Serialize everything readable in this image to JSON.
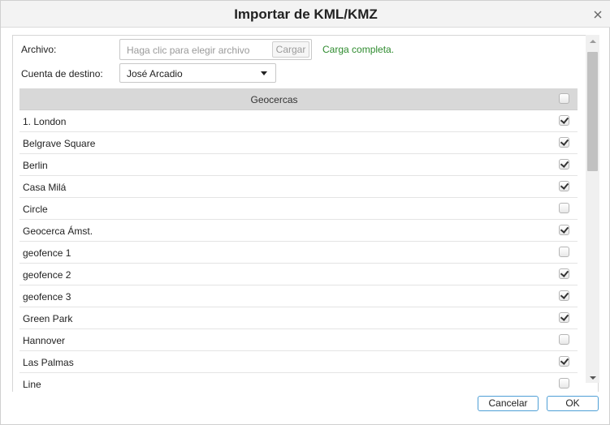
{
  "dialog": {
    "title": "Importar de KML/KMZ",
    "close_icon": "close-icon"
  },
  "form": {
    "file_label": "Archivo:",
    "file_placeholder": "Haga clic para elegir archivo",
    "upload_label": "Cargar",
    "status": "Carga completa.",
    "status_color": "#2e8b2e",
    "account_label": "Cuenta de destino:",
    "account_value": "José Arcadio"
  },
  "table": {
    "header": "Geocercas",
    "header_checked": false,
    "rows": [
      {
        "name": "1. London",
        "checked": true
      },
      {
        "name": "Belgrave Square",
        "checked": true
      },
      {
        "name": "Berlin",
        "checked": true
      },
      {
        "name": "Casa Milá",
        "checked": true
      },
      {
        "name": "Circle",
        "checked": false
      },
      {
        "name": "Geocerca Ámst.",
        "checked": true
      },
      {
        "name": "geofence 1",
        "checked": false
      },
      {
        "name": "geofence 2",
        "checked": true
      },
      {
        "name": "geofence 3",
        "checked": true
      },
      {
        "name": "Green Park",
        "checked": true
      },
      {
        "name": "Hannover",
        "checked": false
      },
      {
        "name": "Las Palmas",
        "checked": true
      },
      {
        "name": "Line",
        "checked": false
      }
    ]
  },
  "footer": {
    "cancel_label": "Cancelar",
    "ok_label": "OK",
    "accent_color": "#4f9fd6"
  }
}
